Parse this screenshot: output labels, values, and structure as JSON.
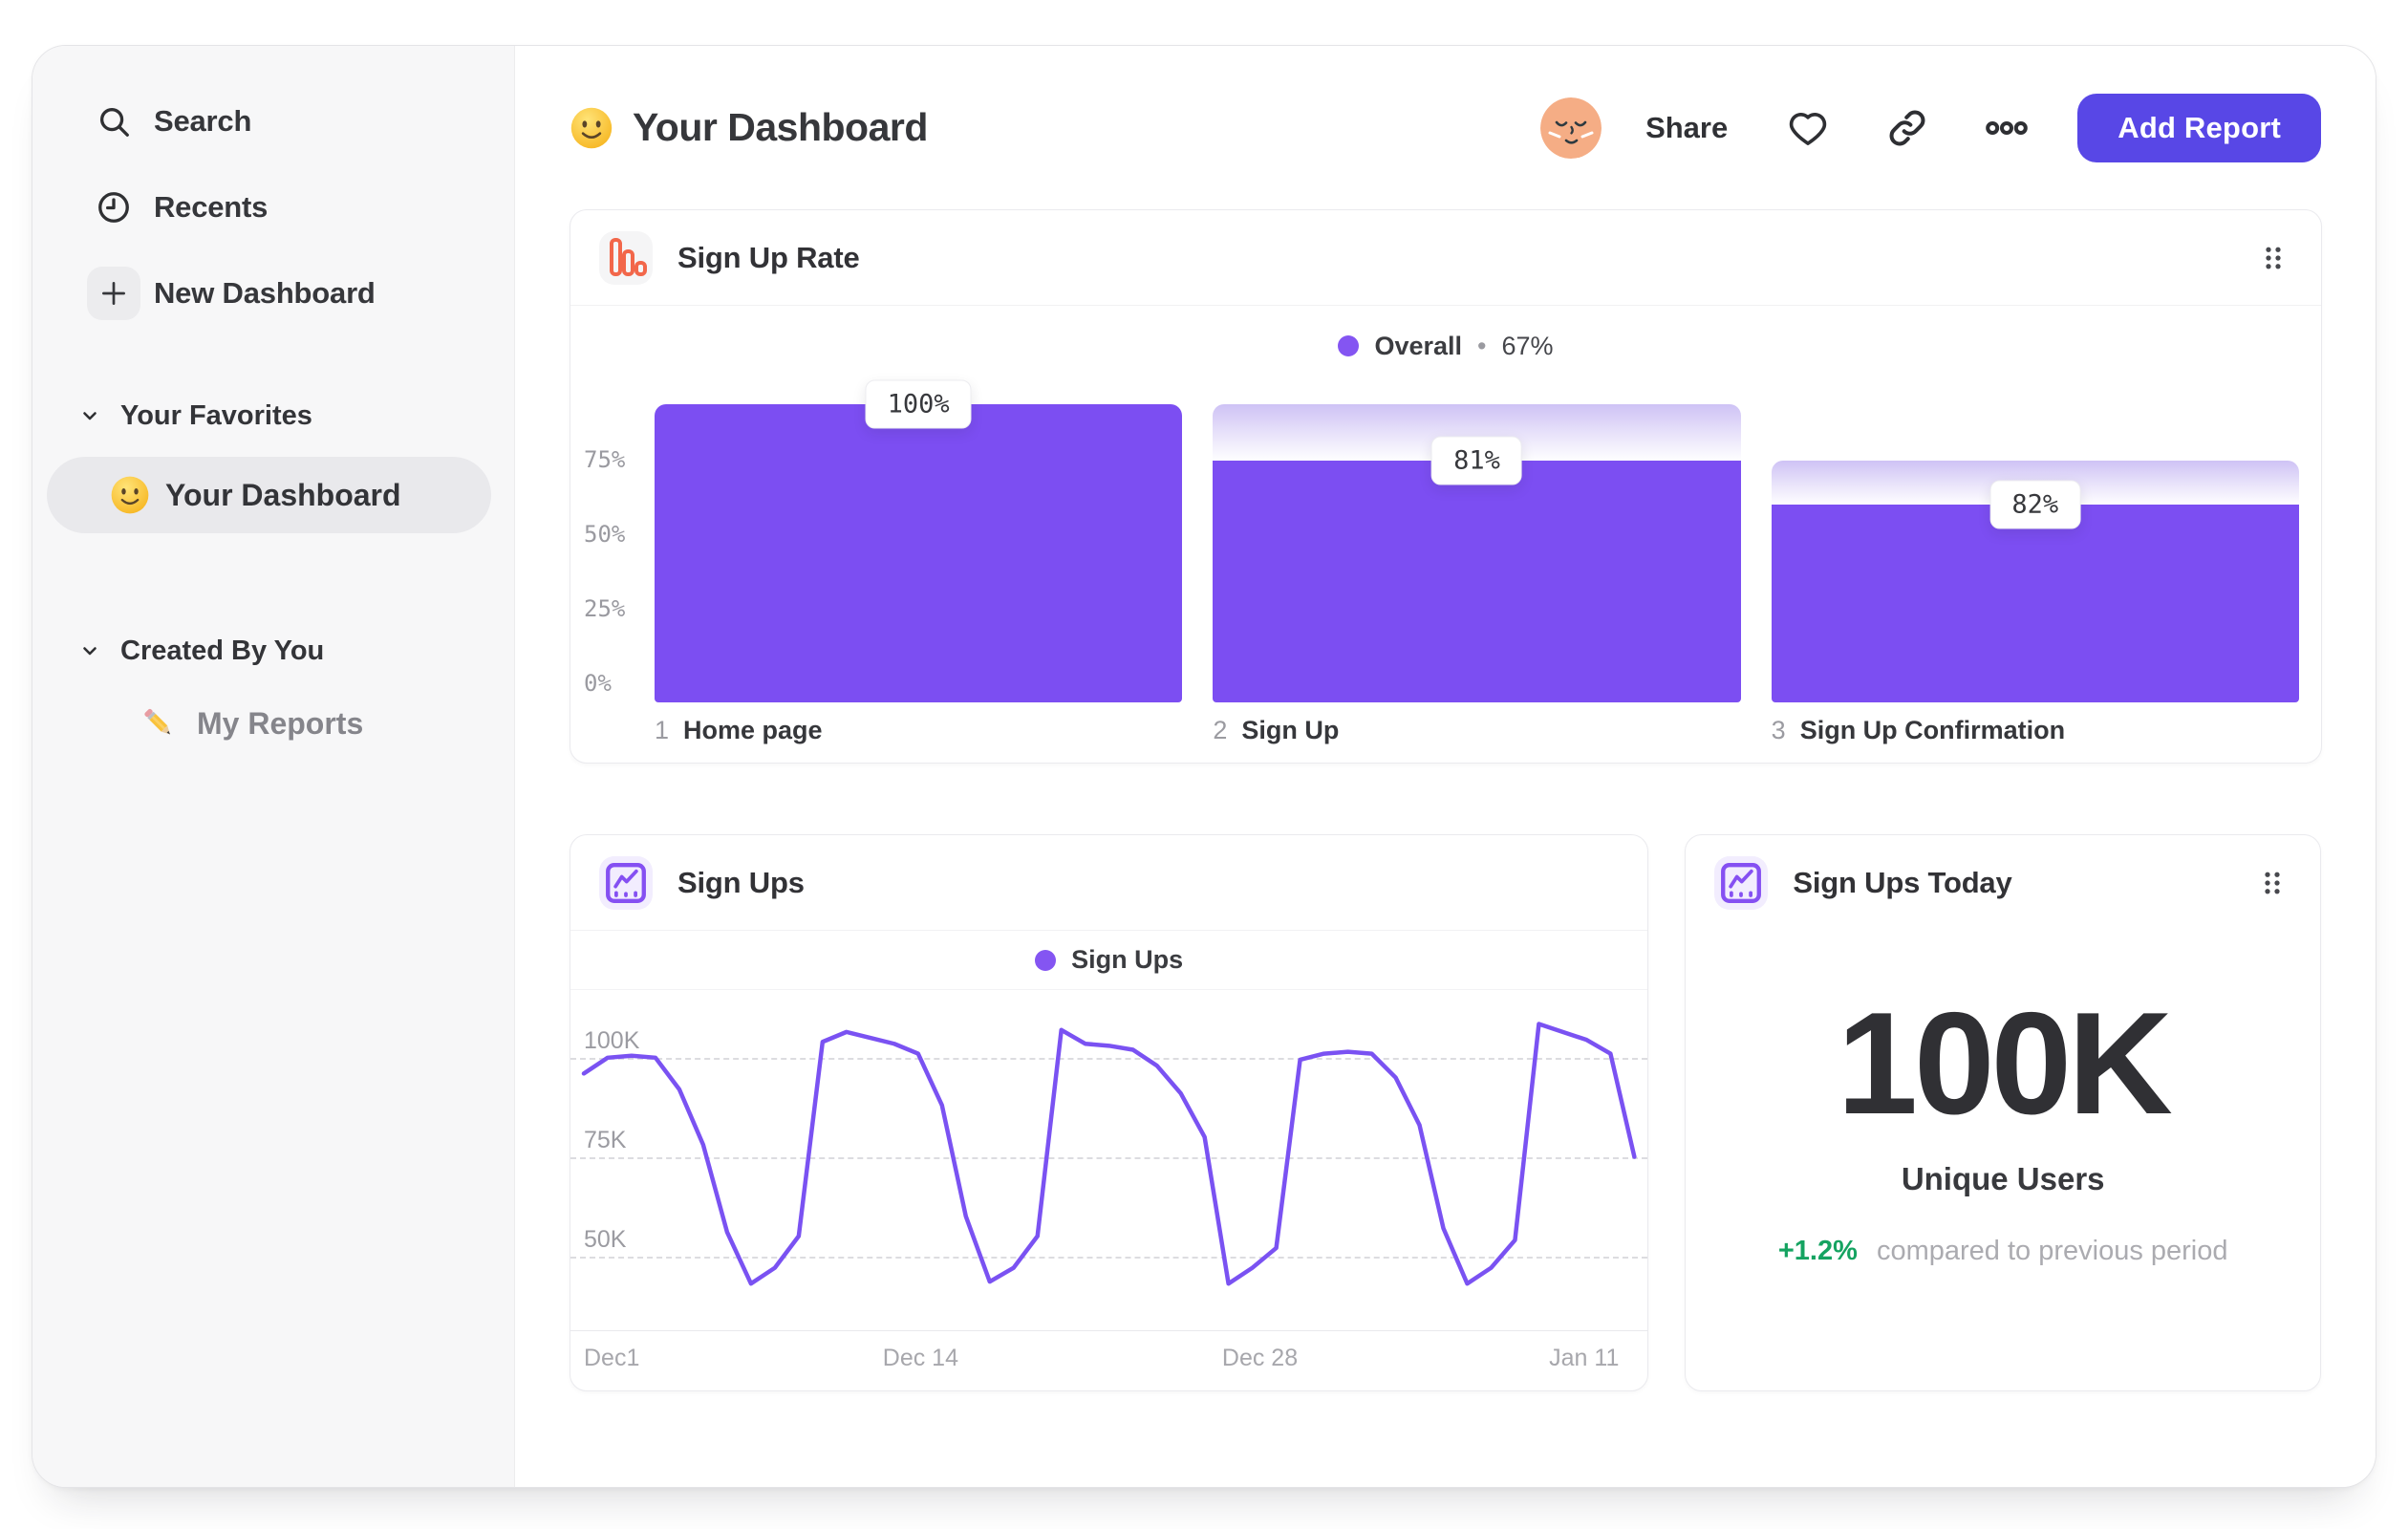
{
  "colors": {
    "accent_button": "#5847e6",
    "bar_purple": "#7c4ef2",
    "bar_gradient_top": "#cec2f5",
    "line_purple": "#7a52f2",
    "legend_dot": "#8455f2",
    "funnel_icon_orange": "#f2674a",
    "delta_green": "#15a361",
    "sidebar_bg": "#f7f7f8"
  },
  "sidebar": {
    "items": [
      {
        "label": "Search",
        "icon": "search-icon"
      },
      {
        "label": "Recents",
        "icon": "recents-icon"
      },
      {
        "label": "New Dashboard",
        "icon": "plus-icon"
      }
    ],
    "sections": [
      {
        "label": "Your Favorites",
        "items": [
          {
            "label": "Your Dashboard",
            "icon": "smiley-emoji",
            "selected": true
          }
        ]
      },
      {
        "label": "Created By You",
        "items": [
          {
            "label": "My Reports",
            "icon": "pencil-emoji",
            "selected": false
          }
        ]
      }
    ]
  },
  "header": {
    "emoji": "smiley",
    "title": "Your Dashboard",
    "share_label": "Share",
    "add_report_label": "Add Report"
  },
  "cards": {
    "signup_rate": {
      "title": "Sign Up Rate"
    },
    "signups": {
      "title": "Sign Ups"
    },
    "signups_today": {
      "title": "Sign Ups Today",
      "value": "100K",
      "caption": "Unique Users",
      "delta": "+1.2%",
      "delta_caption": "compared to previous period"
    }
  },
  "chart_data": [
    {
      "type": "bar",
      "subtype": "funnel",
      "title": "Sign Up Rate",
      "legend": {
        "label": "Overall",
        "sep": "•",
        "value": "67%"
      },
      "ylim": [
        0,
        100
      ],
      "yticks": [
        {
          "label": "75%",
          "value": 75
        },
        {
          "label": "50%",
          "value": 50
        },
        {
          "label": "25%",
          "value": 25
        },
        {
          "label": "0%",
          "value": 0
        }
      ],
      "steps": [
        {
          "index": "1",
          "name": "Home page",
          "label": "100%",
          "conversion_from_previous_pct": 100,
          "overall_pct": 100,
          "previous_overall_pct": 100
        },
        {
          "index": "2",
          "name": "Sign Up",
          "label": "81%",
          "conversion_from_previous_pct": 81,
          "overall_pct": 81,
          "previous_overall_pct": 100
        },
        {
          "index": "3",
          "name": "Sign Up Confirmation",
          "label": "82%",
          "conversion_from_previous_pct": 82,
          "overall_pct": 66.4,
          "previous_overall_pct": 81
        }
      ]
    },
    {
      "type": "line",
      "title": "Sign Ups",
      "legend": {
        "label": "Sign Ups"
      },
      "unit": "K",
      "grid": "dashed-horizontal",
      "yticks": [
        {
          "label": "100K",
          "value": 100
        },
        {
          "label": "75K",
          "value": 75
        },
        {
          "label": "50K",
          "value": 50
        }
      ],
      "xticks": [
        "Dec1",
        "Dec 14",
        "Dec 28",
        "Jan 11"
      ],
      "values": [
        96,
        100,
        100.5,
        100,
        92,
        78,
        56,
        43,
        47,
        55,
        104,
        106.5,
        105,
        103.5,
        101,
        88,
        60,
        43.5,
        47,
        55,
        107,
        103.5,
        103,
        102,
        98,
        91,
        80,
        43,
        47,
        52,
        99.5,
        101,
        101.5,
        101,
        95,
        83,
        57,
        43,
        47,
        54,
        108.5,
        106.5,
        104.5,
        101,
        75
      ]
    }
  ]
}
